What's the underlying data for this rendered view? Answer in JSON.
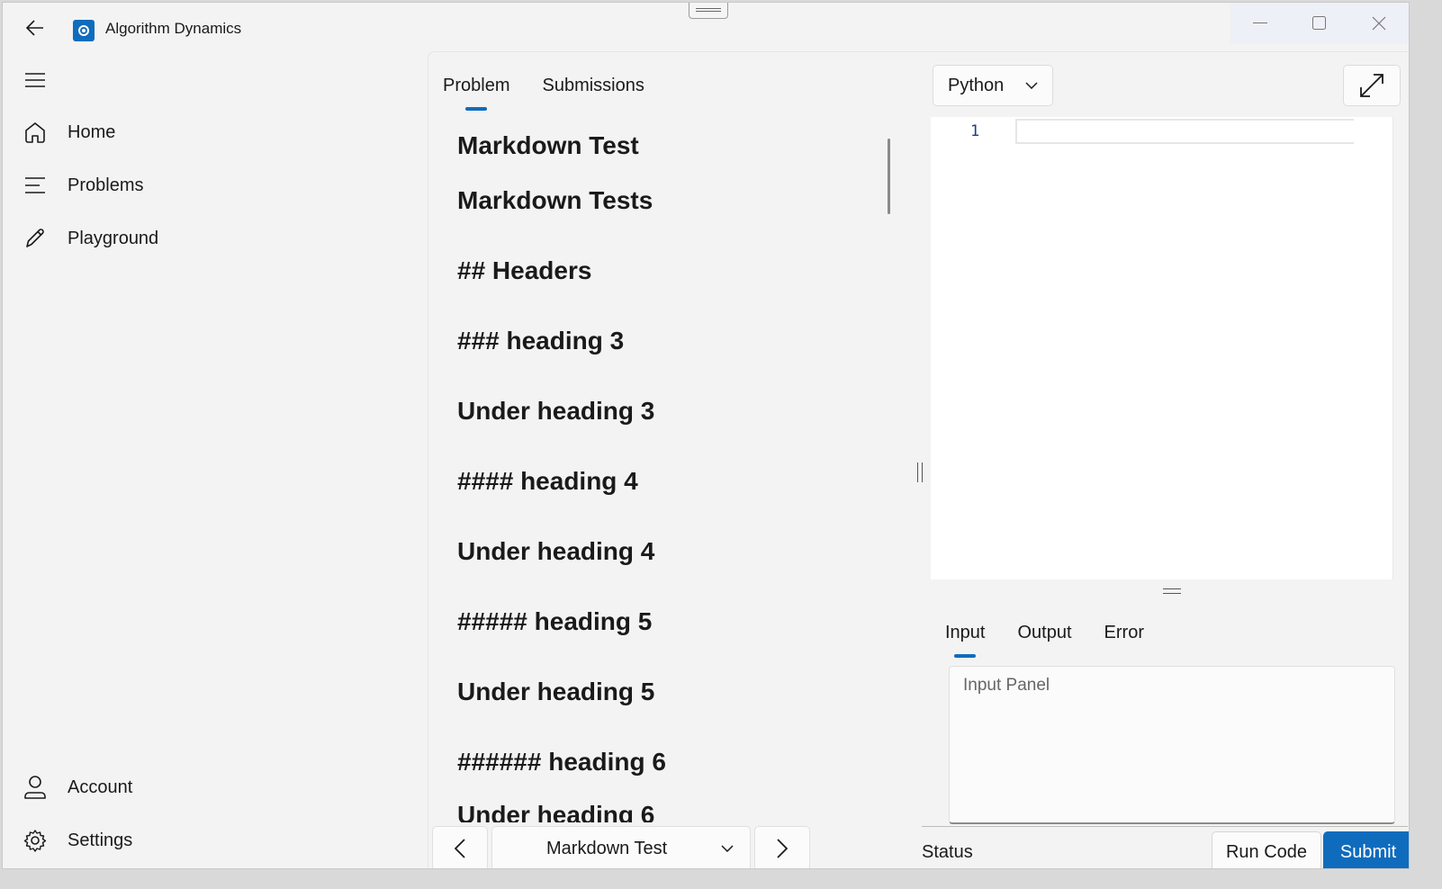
{
  "app": {
    "title": "Algorithm Dynamics",
    "accent_color": "#0f6cbd"
  },
  "window_controls": [
    "minimize-icon",
    "maximize-icon",
    "close-icon"
  ],
  "sidebar": {
    "top_items": [
      {
        "label": "Home",
        "icon": "home-icon"
      },
      {
        "label": "Problems",
        "icon": "list-icon"
      },
      {
        "label": "Playground",
        "icon": "pencil-icon"
      }
    ],
    "bottom_items": [
      {
        "label": "Account",
        "icon": "person-icon"
      },
      {
        "label": "Settings",
        "icon": "gear-icon"
      }
    ]
  },
  "problem_panel": {
    "tabs": [
      {
        "label": "Problem",
        "active": true
      },
      {
        "label": "Submissions",
        "active": false
      }
    ],
    "markdown_lines": [
      "Markdown Test",
      "Markdown Tests",
      "## Headers",
      "### heading 3",
      "Under heading 3",
      "#### heading 4",
      "Under heading 4",
      "##### heading 5",
      "Under heading 5",
      "###### heading 6",
      "Under heading 6"
    ]
  },
  "pager": {
    "selected_problem": "Markdown Test"
  },
  "editor": {
    "language": "Python",
    "line_numbers": [
      "1"
    ]
  },
  "io_panel": {
    "tabs": [
      {
        "label": "Input",
        "active": true
      },
      {
        "label": "Output",
        "active": false
      },
      {
        "label": "Error",
        "active": false
      }
    ],
    "input_placeholder": "Input Panel",
    "status_label": "Status",
    "run_label": "Run Code",
    "submit_label": "Submit"
  }
}
